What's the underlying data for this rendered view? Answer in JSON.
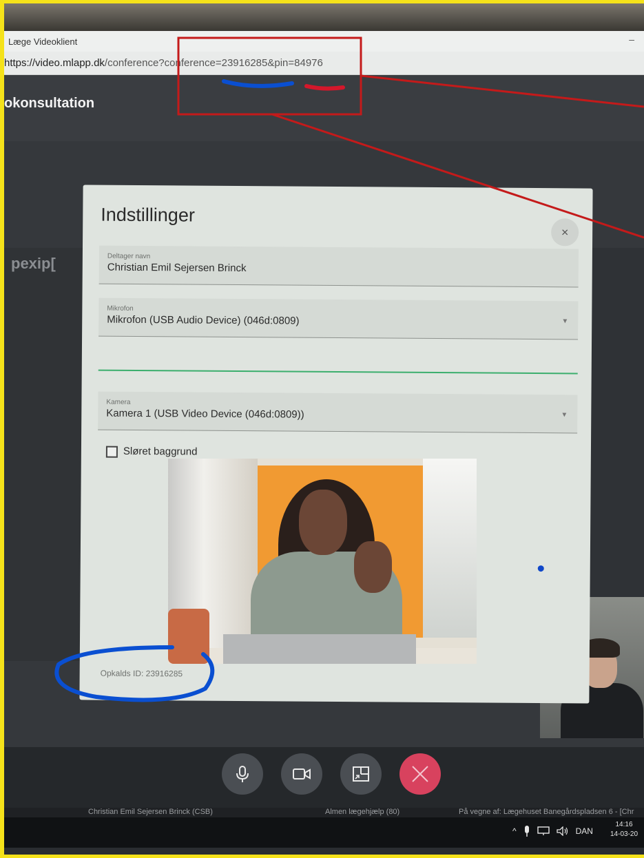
{
  "window": {
    "title": "Læge Videoklient",
    "minimize_glyph": "–"
  },
  "address": {
    "scheme_host": "https://video.mlapp.dk",
    "path_query": "/conference?conference=23916285&pin=84976"
  },
  "app": {
    "header_title": "okonsultation",
    "side_logo": "pexip["
  },
  "dialog": {
    "title": "Indstillinger",
    "close_glyph": "×",
    "participant": {
      "label": "Deltager navn",
      "value": "Christian Emil Sejersen Brinck"
    },
    "microphone": {
      "label": "Mikrofon",
      "value": "Mikrofon (USB Audio Device) (046d:0809)"
    },
    "camera": {
      "label": "Kamera",
      "value": "Kamera 1 (USB Video Device (046d:0809))"
    },
    "blur_background": {
      "label": "Sløret baggrund",
      "checked": false
    },
    "call_id_text": "Opkalds ID: 23916285"
  },
  "controls": {
    "mic_icon": "microphone-icon",
    "camera_icon": "camera-icon",
    "layout_icon": "layout-icon",
    "hangup_icon": "hangup-icon"
  },
  "status_bar": {
    "user": "Christian Emil Sejersen Brinck (CSB)",
    "department": "Almen lægehjælp (80)",
    "on_behalf": "På vegne af: Lægehuset Banegårdspladsen 6 - [Chr"
  },
  "taskbar": {
    "language": "DAN",
    "time": "14:16",
    "date": "14-03-20"
  },
  "colors": {
    "annotation_red": "#c41a1a",
    "annotation_blue": "#0a4fd1",
    "hangup": "#d8425e",
    "accent_green": "#3bae6d"
  }
}
